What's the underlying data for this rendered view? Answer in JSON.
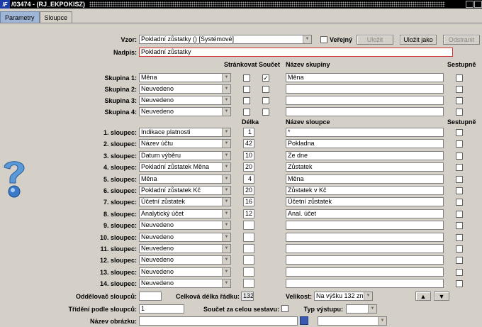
{
  "window": {
    "title": "/03474 - (RJ_EKPOKISZ)",
    "logo": "IF"
  },
  "tabs": [
    {
      "label": "Parametry"
    },
    {
      "label": "Sloupce"
    }
  ],
  "vzor": {
    "label": "Vzor:",
    "value": "Pokladní zůstatky   ()   [Systémové]",
    "verejny_label": "Veřejný",
    "verejny_checked": false,
    "ulozit": "Uložit",
    "ulozit_jako": "Uložit jako",
    "odstranit": "Odstranit"
  },
  "nadpis": {
    "label": "Nadpis:",
    "value": "Pokladní zůstatky"
  },
  "group_headers": {
    "strankovat": "Stránkovat",
    "soucet": "Součet",
    "nazev": "Název skupiny",
    "sestupne": "Sestupně"
  },
  "groups": [
    {
      "label": "Skupina 1:",
      "value": "Měna",
      "strankovat": false,
      "soucet": true,
      "nazev": "Měna",
      "sestupne": false
    },
    {
      "label": "Skupina 2:",
      "value": "Neuvedeno",
      "strankovat": false,
      "soucet": false,
      "nazev": "",
      "sestupne": false
    },
    {
      "label": "Skupina 3:",
      "value": "Neuvedeno",
      "strankovat": false,
      "soucet": false,
      "nazev": "",
      "sestupne": false
    },
    {
      "label": "Skupina 4:",
      "value": "Neuvedeno",
      "strankovat": false,
      "soucet": false,
      "nazev": "",
      "sestupne": false
    }
  ],
  "col_headers": {
    "delka": "Délka",
    "nazev": "Název sloupce",
    "sestupne": "Sestupně"
  },
  "columns": [
    {
      "label": "1. sloupec:",
      "value": "Indikace platnosti",
      "delka": "1",
      "nazev": "*"
    },
    {
      "label": "2. sloupec:",
      "value": "Název účtu",
      "delka": "42",
      "nazev": "Pokladna"
    },
    {
      "label": "3. sloupec:",
      "value": "Datum výběru",
      "delka": "10",
      "nazev": "Ze dne"
    },
    {
      "label": "4. sloupec:",
      "value": "Pokladní zůstatek Měna",
      "delka": "20",
      "nazev": "Zůstatek"
    },
    {
      "label": "5. sloupec:",
      "value": "Měna",
      "delka": "4",
      "nazev": "Měna"
    },
    {
      "label": "6. sloupec:",
      "value": "Pokladní zůstatek Kč",
      "delka": "20",
      "nazev": "Zůstatek v Kč"
    },
    {
      "label": "7. sloupec:",
      "value": "Účetní zůstatek",
      "delka": "16",
      "nazev": "Účetní zůstatek"
    },
    {
      "label": "8. sloupec:",
      "value": "Analytický účet",
      "delka": "12",
      "nazev": "Anal. účet"
    },
    {
      "label": "9. sloupec:",
      "value": "Neuvedeno",
      "delka": "",
      "nazev": ""
    },
    {
      "label": "10. sloupec:",
      "value": "Neuvedeno",
      "delka": "",
      "nazev": ""
    },
    {
      "label": "11. sloupec:",
      "value": "Neuvedeno",
      "delka": "",
      "nazev": ""
    },
    {
      "label": "12. sloupec:",
      "value": "Neuvedeno",
      "delka": "",
      "nazev": ""
    },
    {
      "label": "13. sloupec:",
      "value": "Neuvedeno",
      "delka": "",
      "nazev": ""
    },
    {
      "label": "14. sloupec:",
      "value": "Neuvedeno",
      "delka": "",
      "nazev": ""
    }
  ],
  "footer": {
    "oddelovac_label": "Oddělovač sloupců:",
    "oddelovac_value": "",
    "celkova_label": "Celková délka řádku:",
    "celkova_value": "132",
    "velikost_label": "Velikost:",
    "velikost_value": "Na výšku 132 zn.",
    "trideni_label": "Třídění podle sloupců:",
    "trideni_value": "1",
    "soucet_label": "Součet za celou sestavu:",
    "soucet_checked": false,
    "typ_label": "Typ výstupu:",
    "typ_value": "",
    "obrazek_label": "Název obrázku:",
    "obrazek_value": "",
    "obrazek_select": ""
  },
  "colors": {
    "title_bar": "#000000",
    "active_tab": "#9fb6d6",
    "background": "#d4d0c8",
    "nadpis_border": "#d03030"
  }
}
